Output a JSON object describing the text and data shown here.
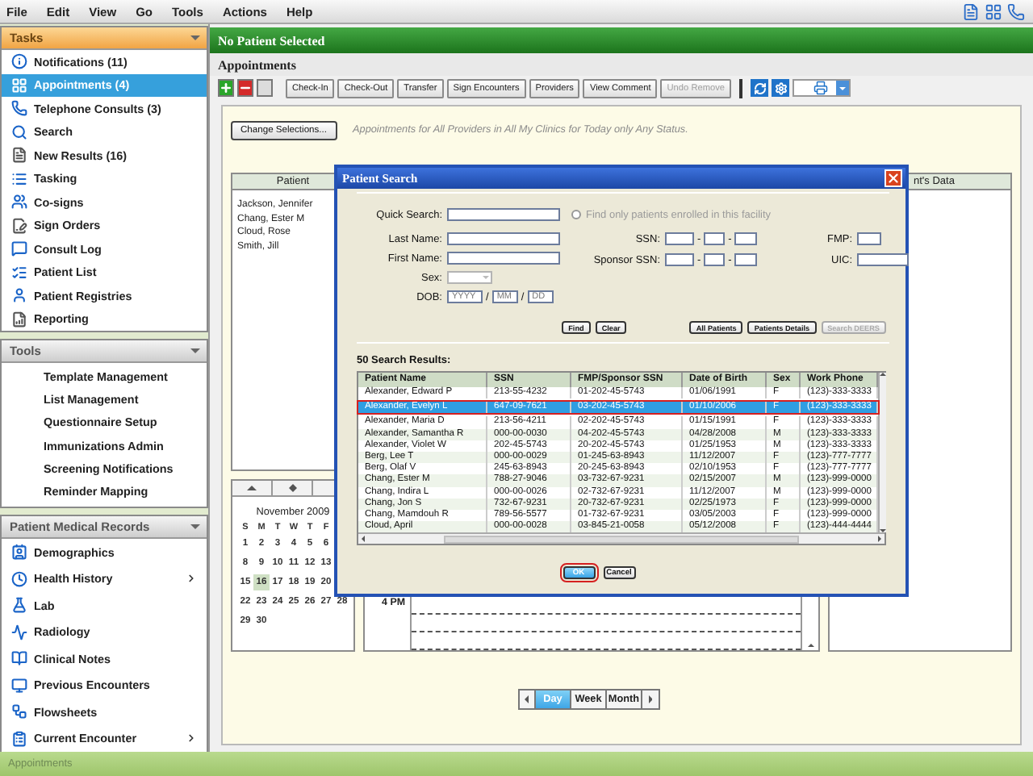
{
  "menu": [
    "File",
    "Edit",
    "View",
    "Go",
    "Tools",
    "Actions",
    "Help"
  ],
  "sidebar": [
    {
      "title": "Tasks",
      "highlighted": true,
      "items": [
        {
          "label": "Notifications (11)",
          "selected": false
        },
        {
          "label": "Appointments (4)",
          "selected": true
        },
        {
          "label": "Telephone Consults (3)",
          "selected": false
        },
        {
          "label": "Search",
          "selected": false
        },
        {
          "label": "New Results (16)",
          "selected": false
        },
        {
          "label": "Tasking",
          "selected": false
        },
        {
          "label": "Co-signs",
          "selected": false
        },
        {
          "label": "Sign Orders",
          "selected": false
        },
        {
          "label": "Consult Log",
          "selected": false
        },
        {
          "label": "Patient List",
          "selected": false
        },
        {
          "label": "Patient Registries",
          "selected": false
        },
        {
          "label": "Reporting",
          "selected": false
        }
      ]
    },
    {
      "title": "Tools",
      "highlighted": false,
      "items": [
        {
          "label": "Template Management",
          "selected": false
        },
        {
          "label": "List Management",
          "selected": false
        },
        {
          "label": "Questionnaire Setup",
          "selected": false
        },
        {
          "label": "Immunizations Admin",
          "selected": false
        },
        {
          "label": "Screening Notifications",
          "selected": false
        },
        {
          "label": "Reminder Mapping",
          "selected": false
        }
      ]
    },
    {
      "title": "Patient Medical Records",
      "highlighted": false,
      "items": [
        {
          "label": "Demographics",
          "selected": false,
          "has_submenu": false
        },
        {
          "label": "Health History",
          "selected": false,
          "has_submenu": true
        },
        {
          "label": "Lab",
          "selected": false,
          "has_submenu": false
        },
        {
          "label": "Radiology",
          "selected": false,
          "has_submenu": false
        },
        {
          "label": "Clinical Notes",
          "selected": false,
          "has_submenu": false
        },
        {
          "label": "Previous Encounters",
          "selected": false,
          "has_submenu": false
        },
        {
          "label": "Flowsheets",
          "selected": false,
          "has_submenu": false
        },
        {
          "label": "Current Encounter",
          "selected": false,
          "has_submenu": true
        }
      ]
    }
  ],
  "banner": "No Patient Selected",
  "page_title": "Appointments",
  "toolbar": [
    {
      "label": "Check-In",
      "disabled": false
    },
    {
      "label": "Check-Out",
      "disabled": false
    },
    {
      "label": "Transfer",
      "disabled": false
    },
    {
      "label": "Sign Encounters",
      "disabled": false
    },
    {
      "label": "Providers",
      "disabled": false
    },
    {
      "label": "View Comment",
      "disabled": false
    },
    {
      "label": "Undo Remove",
      "disabled": true
    }
  ],
  "filter": {
    "button": "Change Selections...",
    "summary": "Appointments for All Providers in All My Clinics for Today only Any Status."
  },
  "patient_panel": {
    "header": "Patient",
    "patients": [
      "Jackson, Jennifer",
      "Chang, Ester M",
      "Cloud, Rose",
      "Smith, Jill"
    ]
  },
  "calendar": {
    "month": "November 2009",
    "weekdays": [
      "S",
      "M",
      "T",
      "W",
      "T",
      "F"
    ],
    "weeks": [
      [
        {
          "day": "1",
          "selected": false
        },
        {
          "day": "2",
          "selected": false
        },
        {
          "day": "3",
          "selected": false
        },
        {
          "day": "4",
          "selected": false
        },
        {
          "day": "5",
          "selected": false
        },
        {
          "day": "6",
          "selected": false
        }
      ],
      [
        {
          "day": "8",
          "selected": false
        },
        {
          "day": "9",
          "selected": false
        },
        {
          "day": "10",
          "selected": false
        },
        {
          "day": "11",
          "selected": false
        },
        {
          "day": "12",
          "selected": false
        },
        {
          "day": "13",
          "selected": false
        }
      ],
      [
        {
          "day": "15",
          "selected": false
        },
        {
          "day": "16",
          "selected": true
        },
        {
          "day": "17",
          "selected": false
        },
        {
          "day": "18",
          "selected": false
        },
        {
          "day": "19",
          "selected": false
        },
        {
          "day": "20",
          "selected": false
        }
      ],
      [
        {
          "day": "22",
          "selected": false
        },
        {
          "day": "23",
          "selected": false
        },
        {
          "day": "24",
          "selected": false
        },
        {
          "day": "25",
          "selected": false
        },
        {
          "day": "26",
          "selected": false
        },
        {
          "day": "27",
          "selected": false
        },
        {
          "day": "28",
          "selected": false
        }
      ],
      [
        {
          "day": "29",
          "selected": false
        },
        {
          "day": "30",
          "selected": false
        }
      ]
    ]
  },
  "schedule": {
    "time": "4 PM"
  },
  "data_panel": {
    "header": "nt's Data"
  },
  "view_switch": [
    {
      "label": "Day",
      "selected": true
    },
    {
      "label": "Week",
      "selected": false
    },
    {
      "label": "Month",
      "selected": false
    }
  ],
  "status_bar": "Appointments",
  "dialog": {
    "title": "Patient Search",
    "quick_search": {
      "label": "Quick Search:"
    },
    "facility_option": {
      "label": "Find only patients enrolled in this facility",
      "checked": false
    },
    "fields": {
      "last_name": "Last Name:",
      "first_name": "First Name:",
      "sex": "Sex:",
      "dob": "DOB:",
      "dob_placeholders": [
        "YYYY",
        "MM",
        "DD"
      ],
      "dob_separators": [
        "/",
        "/"
      ],
      "ssn": "SSN:",
      "ssn_separators": [
        "-",
        "-"
      ],
      "sponsor_ssn": "Sponsor SSN:",
      "sponsor_separators": [
        "-",
        "-"
      ],
      "fmp": "FMP:",
      "uic": "UIC:"
    },
    "search_buttons": [
      {
        "label": "Find",
        "disabled": false
      },
      {
        "label": "Clear",
        "disabled": false
      },
      {
        "label": "All Patients",
        "disabled": false
      },
      {
        "label": "Patients Details",
        "disabled": false
      },
      {
        "label": "Search DEERS",
        "disabled": true
      }
    ],
    "results_label": "50 Search Results:",
    "columns": [
      "Patient Name",
      "SSN",
      "FMP/Sponsor SSN",
      "Date of Birth",
      "Sex",
      "Work Phone"
    ],
    "rows": [
      {
        "cells": [
          "Alexander, Edward P",
          "213-55-4232",
          "01-202-45-5743",
          "01/06/1991",
          "F",
          "(123)-333-3333"
        ],
        "selected": false,
        "callout": false
      },
      {
        "cells": [
          "Alexander, Evelyn L",
          "647-09-7621",
          "03-202-45-5743",
          "01/10/2006",
          "F",
          "(123)-333-3333"
        ],
        "selected": true,
        "callout": true
      },
      {
        "cells": [
          "Alexander, Maria D",
          "213-56-4211",
          "02-202-45-5743",
          "01/15/1991",
          "F",
          "(123)-333-3333"
        ],
        "selected": false,
        "callout": false
      },
      {
        "cells": [
          "Alexander, Samantha R",
          "000-00-0030",
          "04-202-45-5743",
          "04/28/2008",
          "M",
          "(123)-333-3333"
        ],
        "selected": false,
        "callout": false
      },
      {
        "cells": [
          "Alexander, Violet W",
          "202-45-5743",
          "20-202-45-5743",
          "01/25/1953",
          "M",
          "(123)-333-3333"
        ],
        "selected": false,
        "callout": false
      },
      {
        "cells": [
          "Berg, Lee T",
          "000-00-0029",
          "01-245-63-8943",
          "11/12/2007",
          "F",
          "(123)-777-7777"
        ],
        "selected": false,
        "callout": false
      },
      {
        "cells": [
          "Berg, Olaf V",
          "245-63-8943",
          "20-245-63-8943",
          "02/10/1953",
          "F",
          "(123)-777-7777"
        ],
        "selected": false,
        "callout": false
      },
      {
        "cells": [
          "Chang, Ester M",
          "788-27-9046",
          "03-732-67-9231",
          "02/15/2007",
          "M",
          "(123)-999-0000"
        ],
        "selected": false,
        "callout": false
      },
      {
        "cells": [
          "Chang, Indira L",
          "000-00-0026",
          "02-732-67-9231",
          "11/12/2007",
          "M",
          "(123)-999-0000"
        ],
        "selected": false,
        "callout": false
      },
      {
        "cells": [
          "Chang, Jon S",
          "732-67-9231",
          "20-732-67-9231",
          "02/25/1973",
          "F",
          "(123)-999-0000"
        ],
        "selected": false,
        "callout": false
      },
      {
        "cells": [
          "Chang, Mamdouh R",
          "789-56-5577",
          "01-732-67-9231",
          "03/05/2003",
          "F",
          "(123)-999-0000"
        ],
        "selected": false,
        "callout": false
      },
      {
        "cells": [
          "Cloud, April",
          "000-00-0028",
          "03-845-21-0058",
          "05/12/2008",
          "F",
          "(123)-444-4444"
        ],
        "selected": false,
        "callout": false
      }
    ],
    "actions": [
      {
        "label": "OK",
        "default": true,
        "callout": true
      },
      {
        "label": "Cancel",
        "default": false,
        "callout": false
      }
    ]
  }
}
